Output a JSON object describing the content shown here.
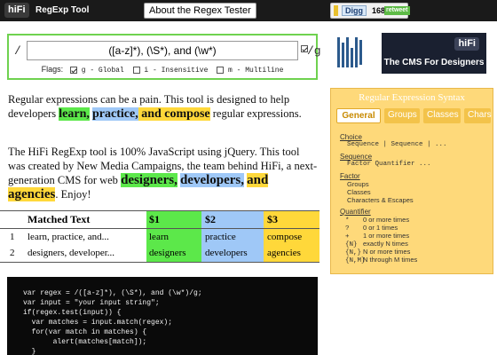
{
  "header": {
    "logo_text": "hiFi",
    "logo_sub": "RegExp Tool",
    "about_button": "About the Regex Tester",
    "digg": {
      "label": "Digg",
      "count": "168",
      "badge": "retweet"
    }
  },
  "regex": {
    "open_slash": "/",
    "value": "([a-z]*), (\\S*), and (\\w*)",
    "close_slash": "/g",
    "flags_label": "Flags:",
    "flags": [
      {
        "label": "g - Global",
        "checked": true
      },
      {
        "label": "i - Insensitive",
        "checked": false
      },
      {
        "label": "m - Multiline",
        "checked": false
      }
    ]
  },
  "ad": {
    "logo": "hiFi",
    "text": "The CMS For Designers"
  },
  "paragraph1": {
    "before": "Regular expressions can be a pain. This tool is designed to help developers ",
    "m1": "learn,",
    "m2": "practice,",
    "m3a": "and",
    "m3b": "compose",
    "after": " regular expressions."
  },
  "paragraph2": {
    "before": "The HiFi RegExp tool is 100% JavaScript using jQuery. This tool was created by New Media Campaigns, the team behind HiFi, a next-generation CMS for web ",
    "m1": "designers,",
    "m2": "developers,",
    "m3a": "and",
    "m3b": "agencies",
    "after": ". Enjoy!"
  },
  "matches": {
    "headers": [
      "Matched Text",
      "$1",
      "$2",
      "$3"
    ],
    "rows": [
      {
        "num": "1",
        "text": "learn, practice, and...",
        "g1": "learn",
        "g2": "practice",
        "g3": "compose"
      },
      {
        "num": "2",
        "text": "designers, developer...",
        "g1": "designers",
        "g2": "developers",
        "g3": "agencies"
      }
    ]
  },
  "code_lines": [
    "var regex = /([a-z]*), (\\S*), and (\\w*)/g;",
    "var input = \"your input string\";",
    "if(regex.test(input)) {",
    "  var matches = input.match(regex);",
    "  for(var match in matches) {",
    "       alert(matches[match]);",
    "  }"
  ],
  "syntax": {
    "title": "Regular Expression Syntax",
    "tabs": [
      "General",
      "Groups",
      "Classes",
      "Chars"
    ],
    "choice_h": "Choice",
    "choice_l": "Sequence | Sequence | ...",
    "sequence_h": "Sequence",
    "sequence_l": "Factor Quantifier ...",
    "factor_h": "Factor",
    "factor_items": [
      "Groups",
      "Classes",
      "Characters & Escapes"
    ],
    "quant_h": "Quantifier",
    "quantifiers": [
      {
        "k": "*",
        "v": "0 or more times"
      },
      {
        "k": "?",
        "v": "0 or 1 times"
      },
      {
        "k": "+",
        "v": "1 or more times"
      },
      {
        "k": "{N}",
        "v": "exactly N times"
      },
      {
        "k": "{N,}",
        "v": "N or more times"
      },
      {
        "k": "{N,M}",
        "v": "N through M times"
      }
    ]
  },
  "colors": {
    "green": "#5ce84a",
    "blue": "#9fc8f7",
    "yellow": "#ffd83a",
    "panel": "#fed97a"
  }
}
